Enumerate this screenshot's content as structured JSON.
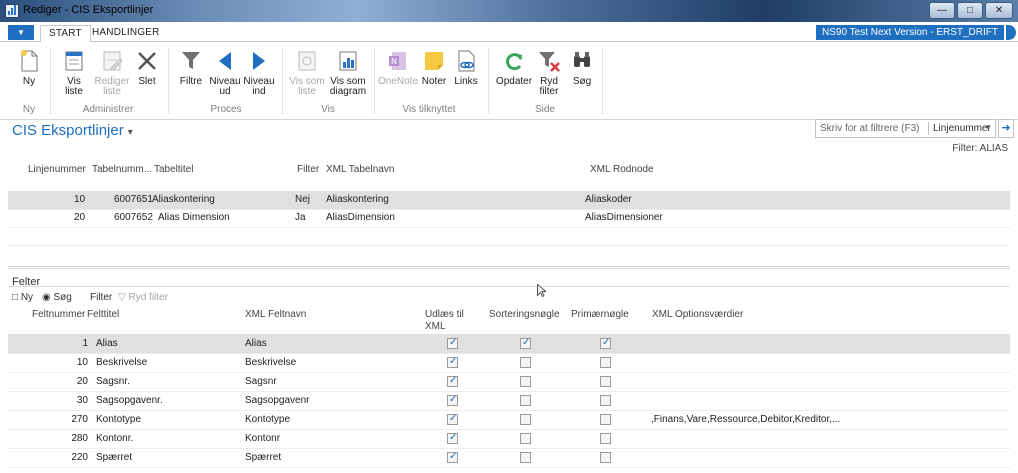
{
  "window": {
    "title": "Rediger - CIS Eksportlinjer",
    "min_icon": "minimize-icon",
    "max_icon": "maximize-icon",
    "close_icon": "close-icon"
  },
  "tabs": {
    "start": "START",
    "handlinger": "HANDLINGER"
  },
  "environment": "NS90 Test Next Version - ERST_DRIFT",
  "ribbon": {
    "groups": {
      "ny": "Ny",
      "administrer": "Administrer",
      "proces": "Proces",
      "vis": "Vis",
      "vis_tilknyttet": "Vis tilknyttet",
      "side": "Side"
    },
    "buttons": {
      "ny": "Ny",
      "vis_liste": [
        "Vis",
        "liste"
      ],
      "rediger_liste": [
        "Rediger",
        "liste"
      ],
      "slet": "Slet",
      "filtre": "Filtre",
      "niveau_ud": [
        "Niveau",
        "ud"
      ],
      "niveau_ind": [
        "Niveau",
        "ind"
      ],
      "vis_som_liste": [
        "Vis som",
        "liste"
      ],
      "vis_som_diagram": [
        "Vis som",
        "diagram"
      ],
      "onenote": "OneNote",
      "noter": "Noter",
      "links": "Links",
      "opdater": "Opdater",
      "ryd_filter": [
        "Ryd",
        "filter"
      ],
      "soeg": "Søg"
    }
  },
  "page": {
    "title": "CIS Eksportlinjer",
    "caret": "▾",
    "filter_placeholder": "Skriv for at filtrere (F3)",
    "filter_field": "Linjenummer",
    "filter_label": "Filter: ALIAS"
  },
  "grid1": {
    "headers": {
      "linjenummer": "Linjenummer",
      "tabelnummer": "Tabelnumm...",
      "tabeltitel": "Tabeltitel",
      "filter": "Filter",
      "xml_tabelnavn": "XML Tabelnavn",
      "xml_rodnode": "XML Rodnode"
    },
    "rows": [
      {
        "linjenummer": "10",
        "tabelnummer": "6007651",
        "tabeltitel": "Aliaskontering",
        "filter": "Nej",
        "xml_tabelnavn": "Aliaskontering",
        "xml_rodnode": "Aliaskoder"
      },
      {
        "linjenummer": "20",
        "tabelnummer": "6007652",
        "tabeltitel": "Alias Dimension",
        "filter": "Ja",
        "xml_tabelnavn": "AliasDimension",
        "xml_rodnode": "AliasDimensioner"
      }
    ]
  },
  "subpage": {
    "title": "Felter",
    "actions": {
      "ny": "Ny",
      "soeg": "Søg",
      "filter": "Filter",
      "ryd_filter": "Ryd filter"
    },
    "headers": {
      "feltnummer": "Feltnummer",
      "felttitel": "Felttitel",
      "xml_feltnavn": "XML Feltnavn",
      "udlaes_1": "Udlæs til",
      "udlaes_2": "XML",
      "sortering": "Sorteringsnøgle",
      "primaer": "Primærnøgle",
      "options": "XML Optionsværdier"
    },
    "rows": [
      {
        "feltnummer": "1",
        "felttitel": "Alias",
        "xml_feltnavn": "Alias",
        "udlaes": true,
        "sortering": true,
        "primaer": true,
        "options": ""
      },
      {
        "feltnummer": "10",
        "felttitel": "Beskrivelse",
        "xml_feltnavn": "Beskrivelse",
        "udlaes": true,
        "sortering": false,
        "primaer": false,
        "options": ""
      },
      {
        "feltnummer": "20",
        "felttitel": "Sagsnr.",
        "xml_feltnavn": "Sagsnr",
        "udlaes": true,
        "sortering": false,
        "primaer": false,
        "options": ""
      },
      {
        "feltnummer": "30",
        "felttitel": "Sagsopgavenr.",
        "xml_feltnavn": "Sagsopgavenr",
        "udlaes": true,
        "sortering": false,
        "primaer": false,
        "options": ""
      },
      {
        "feltnummer": "270",
        "felttitel": "Kontotype",
        "xml_feltnavn": "Kontotype",
        "udlaes": true,
        "sortering": false,
        "primaer": false,
        "options": ",Finans,Vare,Ressource,Debitor,Kreditor,..."
      },
      {
        "feltnummer": "280",
        "felttitel": "Kontonr.",
        "xml_feltnavn": "Kontonr",
        "udlaes": true,
        "sortering": false,
        "primaer": false,
        "options": ""
      },
      {
        "feltnummer": "220",
        "felttitel": "Spærret",
        "xml_feltnavn": "Spærret",
        "udlaes": true,
        "sortering": false,
        "primaer": false,
        "options": ""
      }
    ]
  },
  "colors": {
    "accent": "#1e6fc0",
    "selected_row": "#e0e0e0",
    "green": "#3aa55b",
    "red": "#d83b3b"
  }
}
